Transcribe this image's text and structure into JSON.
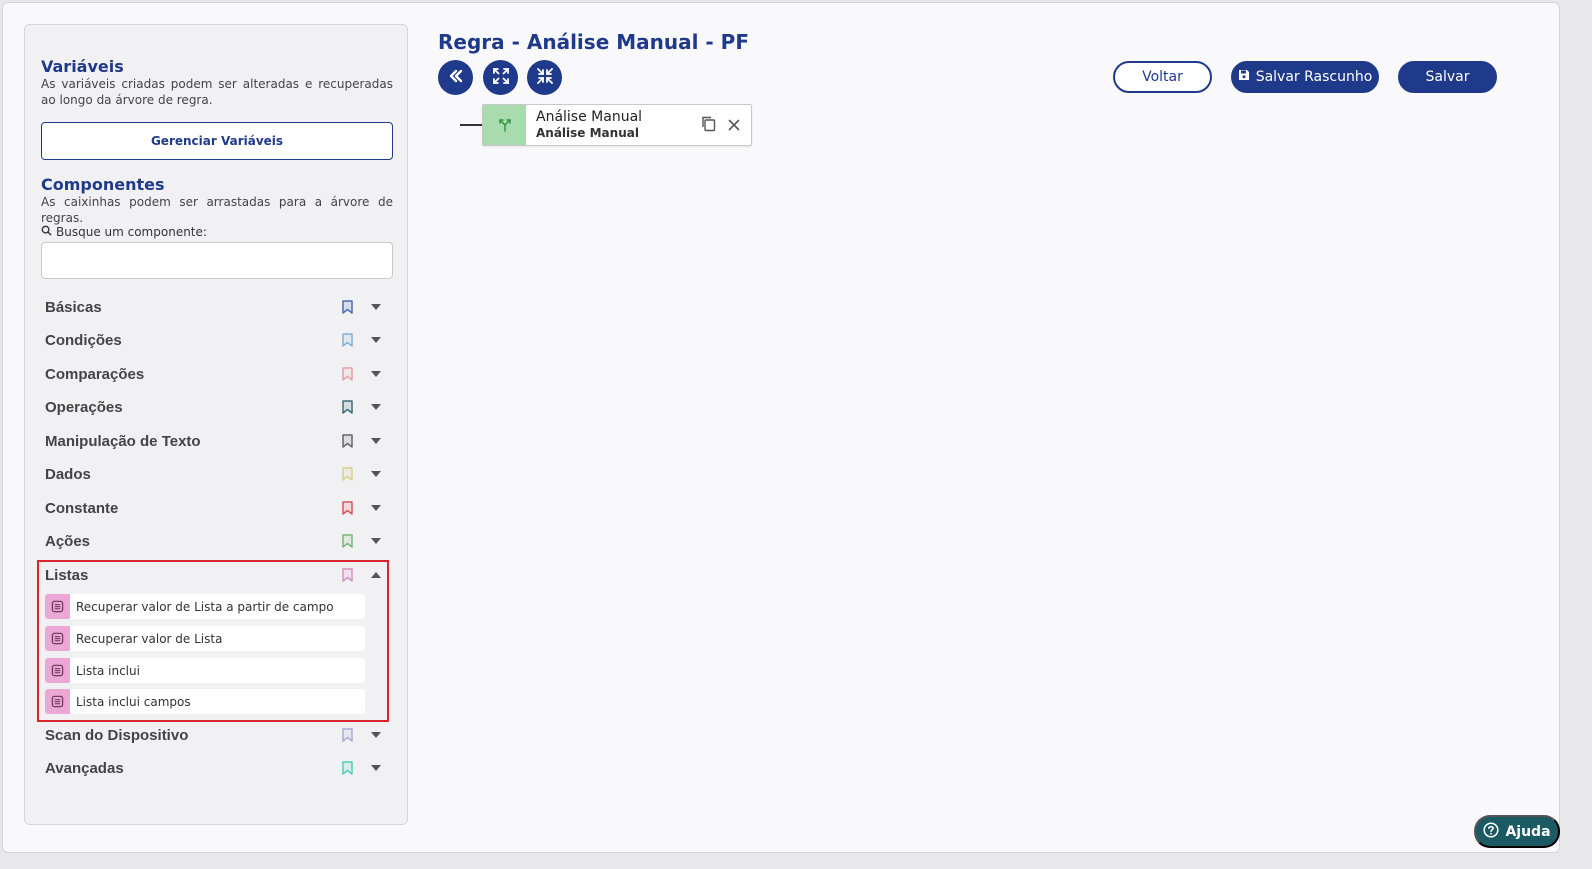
{
  "sidebar": {
    "variables": {
      "title": "Variáveis",
      "description": "As variáveis criadas podem ser alteradas e recuperadas ao longo da árvore de regra.",
      "manage_button": "Gerenciar Variáveis"
    },
    "components": {
      "title": "Componentes",
      "description": "As caixinhas podem ser arrastadas para a árvore de regras.",
      "search_label": "Busque um componente:",
      "search_value": ""
    },
    "categories": [
      {
        "label": "Básicas",
        "color": "#4a6fb0"
      },
      {
        "label": "Condições",
        "color": "#7fb0d8"
      },
      {
        "label": "Comparações",
        "color": "#e8a0a6"
      },
      {
        "label": "Operações",
        "color": "#3f6e7c"
      },
      {
        "label": "Manipulação de Texto",
        "color": "#666666"
      },
      {
        "label": "Dados",
        "color": "#d8d08a"
      },
      {
        "label": "Constante",
        "color": "#d9545d"
      },
      {
        "label": "Ações",
        "color": "#78b878"
      },
      {
        "label": "Listas",
        "color": "#d98fc0"
      },
      {
        "label": "Scan do Dispositivo",
        "color": "#a8acd8"
      },
      {
        "label": "Avançadas",
        "color": "#4fcfb8"
      }
    ],
    "listas_items": [
      "Recuperar valor de Lista a partir de campo",
      "Recuperar valor de Lista",
      "Lista inclui",
      "Lista inclui campos"
    ]
  },
  "main": {
    "title": "Regra - Análise Manual - PF",
    "buttons": {
      "back": "Voltar",
      "save_draft": "Salvar Rascunho",
      "save": "Salvar"
    },
    "node": {
      "title": "Análise Manual",
      "subtitle": "Análise Manual"
    }
  },
  "help": {
    "label": "Ajuda"
  },
  "colors": {
    "primary": "#1f3a8a",
    "highlight": "#d9262c",
    "help_bg": "#1b5a63"
  }
}
